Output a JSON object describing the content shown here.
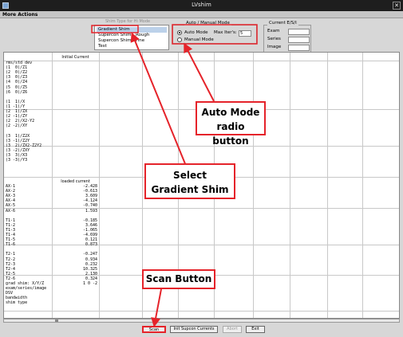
{
  "window": {
    "title": "LVshim",
    "close_glyph": "✕"
  },
  "menu": {
    "label": "More Actions"
  },
  "shim_list": {
    "legend": "Shim Type for Hi Mode",
    "options": [
      "Gradient Shim",
      "Supercon Shim - Rough",
      "Supercon Shim - Fine",
      "Test"
    ],
    "selected_index": 0
  },
  "mode": {
    "legend": "Auto / Manual Mode",
    "auto_label": "Auto Mode",
    "manual_label": "Manual Mode",
    "max_iter_label": "Max Iter's:",
    "max_iter_value": "5",
    "selected": "auto"
  },
  "current": {
    "legend": "Current E/S/I",
    "exam_label": "Exam",
    "series_label": "Series",
    "image_label": "Image"
  },
  "table": {
    "header_initial": "Initial Current",
    "header_loaded": "loaded current",
    "labels": [
      "rms/std dev",
      "(1  0)/Z1",
      "(2  0)/Z2",
      "(3  0)/Z3",
      "(4  0)/Z4",
      "(5  0)/Z5",
      "(6  0)/Z6",
      "",
      "(1  1)/X",
      "(1 -1)/Y",
      "(2  1)/ZX",
      "(2 -1)/ZY",
      "(2  2)/X2-Y2",
      "(2 -2)/XY",
      "",
      "(3  1)/Z2X",
      "(3 -1)/Z2Y",
      "(3  2)/ZX2-Z2Y2",
      "(3 -2)/ZXY",
      "(3  3)/X3",
      "(3 -3)/Y3"
    ],
    "loaded_rows": [
      {
        "label": "AX-1",
        "value": "-2.428"
      },
      {
        "label": "AX-2",
        "value": "-0.613"
      },
      {
        "label": "AX-3",
        "value": "3.609"
      },
      {
        "label": "AX-4",
        "value": "-4.124"
      },
      {
        "label": "AX-5",
        "value": "-0.740"
      },
      {
        "label": "AX-6",
        "value": "1.593"
      },
      {
        "label": "",
        "value": ""
      },
      {
        "label": "T1-1",
        "value": "-0.185"
      },
      {
        "label": "T1-2",
        "value": "3.646"
      },
      {
        "label": "T1-3",
        "value": "-1.065"
      },
      {
        "label": "T1-4",
        "value": "-4.699"
      },
      {
        "label": "T1-5",
        "value": "0.121"
      },
      {
        "label": "T1-6",
        "value": "0.873"
      },
      {
        "label": "",
        "value": ""
      },
      {
        "label": "T2-1",
        "value": "-0.247"
      },
      {
        "label": "T2-2",
        "value": "0.934"
      },
      {
        "label": "T2-3",
        "value": "0.232"
      },
      {
        "label": "T2-4",
        "value": "10.325"
      },
      {
        "label": "T2-5",
        "value": "2.130"
      },
      {
        "label": "T2-6",
        "value": "0.324"
      }
    ],
    "footer_rows": [
      {
        "label": "grad shim: X/Y/Z",
        "value": "1  0  -2"
      },
      {
        "label": "exam/series/image",
        "value": ""
      },
      {
        "label": "DSV",
        "value": ""
      },
      {
        "label": "bandwidth",
        "value": ""
      },
      {
        "label": "shim type",
        "value": ""
      }
    ]
  },
  "buttons": {
    "scan": "Scan",
    "init": "Init Supcon Currents",
    "abort": "Abort",
    "exit": "Exit"
  },
  "annotations": {
    "auto_mode": [
      "Auto Mode",
      "radio button"
    ],
    "select_gradient": [
      "Select",
      "Gradient Shim"
    ],
    "scan_button": "Scan Button",
    "color": "#e5232a"
  }
}
